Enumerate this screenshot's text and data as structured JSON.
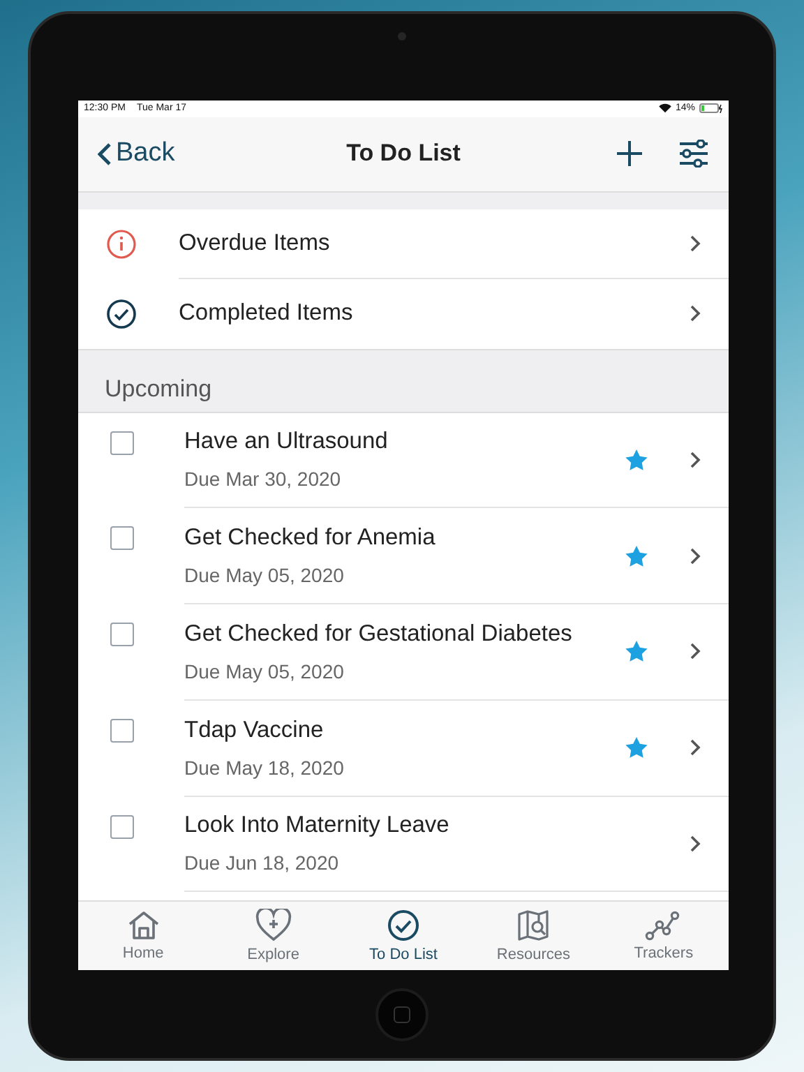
{
  "status_bar": {
    "time": "12:30 PM",
    "date": "Tue Mar 17",
    "battery": "14%"
  },
  "nav": {
    "back": "Back",
    "title": "To Do List"
  },
  "filters": [
    {
      "kind": "overdue",
      "label": "Overdue Items"
    },
    {
      "kind": "completed",
      "label": "Completed Items"
    }
  ],
  "section": "Upcoming",
  "items": [
    {
      "title": "Have an Ultrasound",
      "due": "Due Mar 30, 2020",
      "checked": false,
      "starred": true
    },
    {
      "title": "Get Checked for Anemia",
      "due": "Due May 05, 2020",
      "checked": false,
      "starred": true
    },
    {
      "title": "Get Checked for Gestational Diabetes",
      "due": "Due May 05, 2020",
      "checked": false,
      "starred": true
    },
    {
      "title": "Tdap Vaccine",
      "due": "Due May 18, 2020",
      "checked": false,
      "starred": true
    },
    {
      "title": "Look Into Maternity Leave",
      "due": "Due Jun 18, 2020",
      "checked": false,
      "starred": false
    }
  ],
  "tabs": [
    {
      "kind": "home",
      "label": "Home",
      "selected": false
    },
    {
      "kind": "explore",
      "label": "Explore",
      "selected": false
    },
    {
      "kind": "todo",
      "label": "To Do List",
      "selected": true
    },
    {
      "kind": "resources",
      "label": "Resources",
      "selected": false
    },
    {
      "kind": "trackers",
      "label": "Trackers",
      "selected": false
    }
  ]
}
